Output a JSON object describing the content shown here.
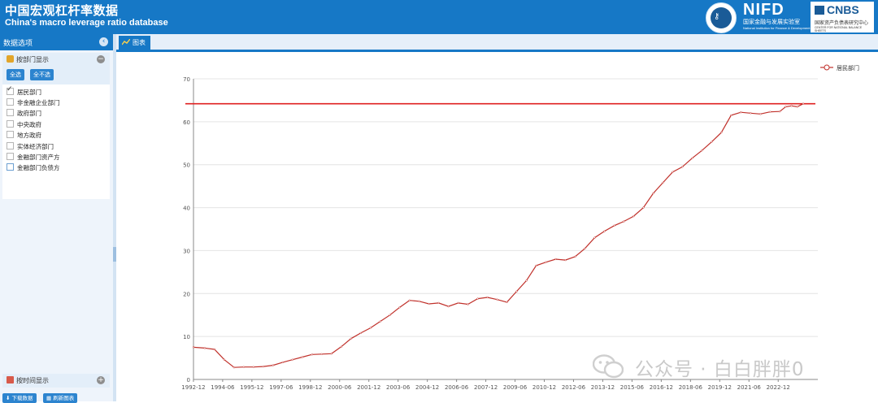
{
  "header": {
    "title_cn": "中国宏观杠杆率数据",
    "title_en": "China's macro leverage ratio database",
    "nifd_mark": "NIFD",
    "nifd_cn": "国家金融与发展实验室",
    "nifd_en": "National Institution for Finance & Development",
    "cnbs_mark": "CNBS",
    "cnbs_cn": "国家资产负债表研究中心",
    "cnbs_en": "CENTER FOR NATIONAL BALANCE SHEETS"
  },
  "sidebar": {
    "title": "数据选项",
    "dept_panel": {
      "label": "按部门显示",
      "select_all": "全选",
      "select_none": "全不选",
      "items": [
        {
          "label": "居民部门",
          "checked": true
        },
        {
          "label": "非金融企业部门",
          "checked": false
        },
        {
          "label": "政府部门",
          "checked": false
        },
        {
          "label": "中央政府",
          "checked": false
        },
        {
          "label": "地方政府",
          "checked": false
        },
        {
          "label": "实体经济部门",
          "checked": false
        },
        {
          "label": "金融部门资产方",
          "checked": false
        },
        {
          "label": "金融部门负债方",
          "checked": false
        }
      ]
    },
    "time_panel": {
      "label": "按时间显示"
    },
    "download_label": "下载数据",
    "refresh_label": "刷新图表"
  },
  "tabs": [
    {
      "label": "图表",
      "active": true
    }
  ],
  "watermark": "公众号 · 白白胖胖0",
  "colors": {
    "accent": "#1678c6",
    "series": "#c0302a",
    "refline": "#e02020"
  },
  "chart_data": {
    "type": "line",
    "title": "",
    "xlabel": "",
    "ylabel": "",
    "ylim": [
      0,
      70
    ],
    "yticks": [
      0,
      10,
      20,
      30,
      40,
      50,
      60,
      70
    ],
    "grid": true,
    "legend_position": "top-right",
    "reference_line": 64.2,
    "xticks": [
      "1992-12",
      "1994-06",
      "1995-12",
      "1997-06",
      "1998-12",
      "2000-06",
      "2001-12",
      "2003-06",
      "2004-12",
      "2006-06",
      "2007-12",
      "2009-06",
      "2010-12",
      "2012-06",
      "2013-12",
      "2015-06",
      "2016-12",
      "2018-06",
      "2019-12",
      "2021-06",
      "2022-12"
    ],
    "series": [
      {
        "name": "居民部门",
        "points": [
          [
            1992.92,
            7.5
          ],
          [
            1993.5,
            7.3
          ],
          [
            1994.0,
            7.0
          ],
          [
            1994.5,
            4.6
          ],
          [
            1995.0,
            2.8
          ],
          [
            1995.5,
            2.9
          ],
          [
            1996.0,
            2.9
          ],
          [
            1996.5,
            3.0
          ],
          [
            1997.0,
            3.3
          ],
          [
            1997.5,
            4.0
          ],
          [
            1998.0,
            4.6
          ],
          [
            1998.5,
            5.2
          ],
          [
            1999.0,
            5.8
          ],
          [
            1999.5,
            5.9
          ],
          [
            2000.0,
            6.0
          ],
          [
            2000.5,
            7.6
          ],
          [
            2001.0,
            9.5
          ],
          [
            2001.5,
            10.8
          ],
          [
            2002.0,
            12.0
          ],
          [
            2002.5,
            13.5
          ],
          [
            2003.0,
            15.0
          ],
          [
            2003.5,
            16.8
          ],
          [
            2004.0,
            18.4
          ],
          [
            2004.5,
            18.2
          ],
          [
            2005.0,
            17.6
          ],
          [
            2005.5,
            17.8
          ],
          [
            2006.0,
            17.0
          ],
          [
            2006.5,
            17.8
          ],
          [
            2007.0,
            17.5
          ],
          [
            2007.5,
            18.8
          ],
          [
            2008.0,
            19.1
          ],
          [
            2008.5,
            18.6
          ],
          [
            2009.0,
            18.0
          ],
          [
            2009.5,
            20.5
          ],
          [
            2010.0,
            23.0
          ],
          [
            2010.5,
            26.5
          ],
          [
            2011.0,
            27.3
          ],
          [
            2011.5,
            28.0
          ],
          [
            2012.0,
            27.8
          ],
          [
            2012.5,
            28.6
          ],
          [
            2013.0,
            30.5
          ],
          [
            2013.5,
            33.0
          ],
          [
            2014.0,
            34.5
          ],
          [
            2014.5,
            35.8
          ],
          [
            2015.0,
            36.8
          ],
          [
            2015.5,
            38.0
          ],
          [
            2016.0,
            40.0
          ],
          [
            2016.5,
            43.3
          ],
          [
            2017.0,
            45.8
          ],
          [
            2017.5,
            48.3
          ],
          [
            2018.0,
            49.5
          ],
          [
            2018.5,
            51.5
          ],
          [
            2019.0,
            53.3
          ],
          [
            2019.5,
            55.3
          ],
          [
            2020.0,
            57.5
          ],
          [
            2020.5,
            61.5
          ],
          [
            2021.0,
            62.2
          ],
          [
            2021.5,
            62.0
          ],
          [
            2022.0,
            61.8
          ],
          [
            2022.5,
            62.3
          ],
          [
            2023.0,
            62.4
          ],
          [
            2023.3,
            63.5
          ],
          [
            2023.6,
            63.7
          ],
          [
            2023.9,
            63.5
          ],
          [
            2024.2,
            64.2
          ]
        ]
      }
    ]
  }
}
